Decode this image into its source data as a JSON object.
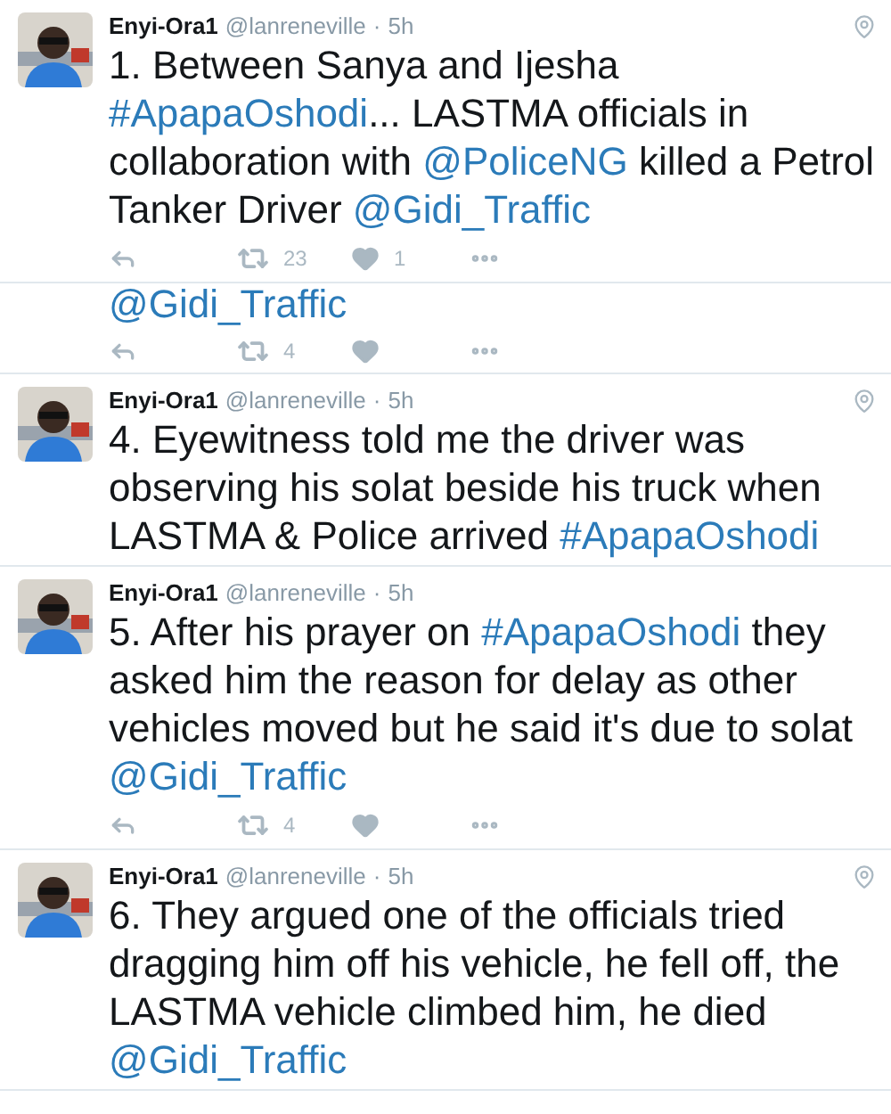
{
  "items": [
    {
      "kind": "tweet",
      "name": "Enyi-Ora1",
      "handle": "@lanreneville",
      "separator": "·",
      "time": "5h",
      "location": true,
      "segments": [
        {
          "kind": "text",
          "text": "1. Between Sanya and Ijesha "
        },
        {
          "kind": "hashtag",
          "text": "#ApapaOshodi"
        },
        {
          "kind": "text",
          "text": "... LASTMA officials in collaboration with "
        },
        {
          "kind": "mention",
          "text": "@PoliceNG"
        },
        {
          "kind": "text",
          "text": " killed a Petrol Tanker Driver "
        },
        {
          "kind": "mention",
          "text": "@Gidi_Traffic"
        }
      ],
      "actions": {
        "retweets": "23",
        "likes": "1"
      }
    },
    {
      "kind": "fragment",
      "segments": [
        {
          "kind": "mention",
          "text": "@Gidi_Traffic"
        }
      ],
      "actions": {
        "retweets": "4"
      }
    },
    {
      "kind": "tweet",
      "name": "Enyi-Ora1",
      "handle": "@lanreneville",
      "separator": "·",
      "time": "5h",
      "location": true,
      "segments": [
        {
          "kind": "text",
          "text": "4. Eyewitness told me the driver was observing his solat beside his truck when LASTMA & Police arrived "
        },
        {
          "kind": "hashtag",
          "text": "#ApapaOshodi"
        }
      ]
    },
    {
      "kind": "tweet",
      "name": "Enyi-Ora1",
      "handle": "@lanreneville",
      "separator": "·",
      "time": "5h",
      "location": false,
      "segments": [
        {
          "kind": "text",
          "text": "5. After his prayer on "
        },
        {
          "kind": "hashtag",
          "text": "#ApapaOshodi"
        },
        {
          "kind": "text",
          "text": " they asked him the reason for delay as other vehicles moved but he said it's due to solat "
        },
        {
          "kind": "mention",
          "text": "@Gidi_Traffic"
        }
      ],
      "actions": {
        "retweets": "4"
      }
    },
    {
      "kind": "tweet",
      "name": "Enyi-Ora1",
      "handle": "@lanreneville",
      "separator": "·",
      "time": "5h",
      "location": true,
      "segments": [
        {
          "kind": "text",
          "text": "6. They argued one of the officials tried dragging him off his vehicle, he fell off, the LASTMA vehicle climbed him, he died "
        },
        {
          "kind": "mention",
          "text": "@Gidi_Traffic"
        }
      ]
    }
  ]
}
